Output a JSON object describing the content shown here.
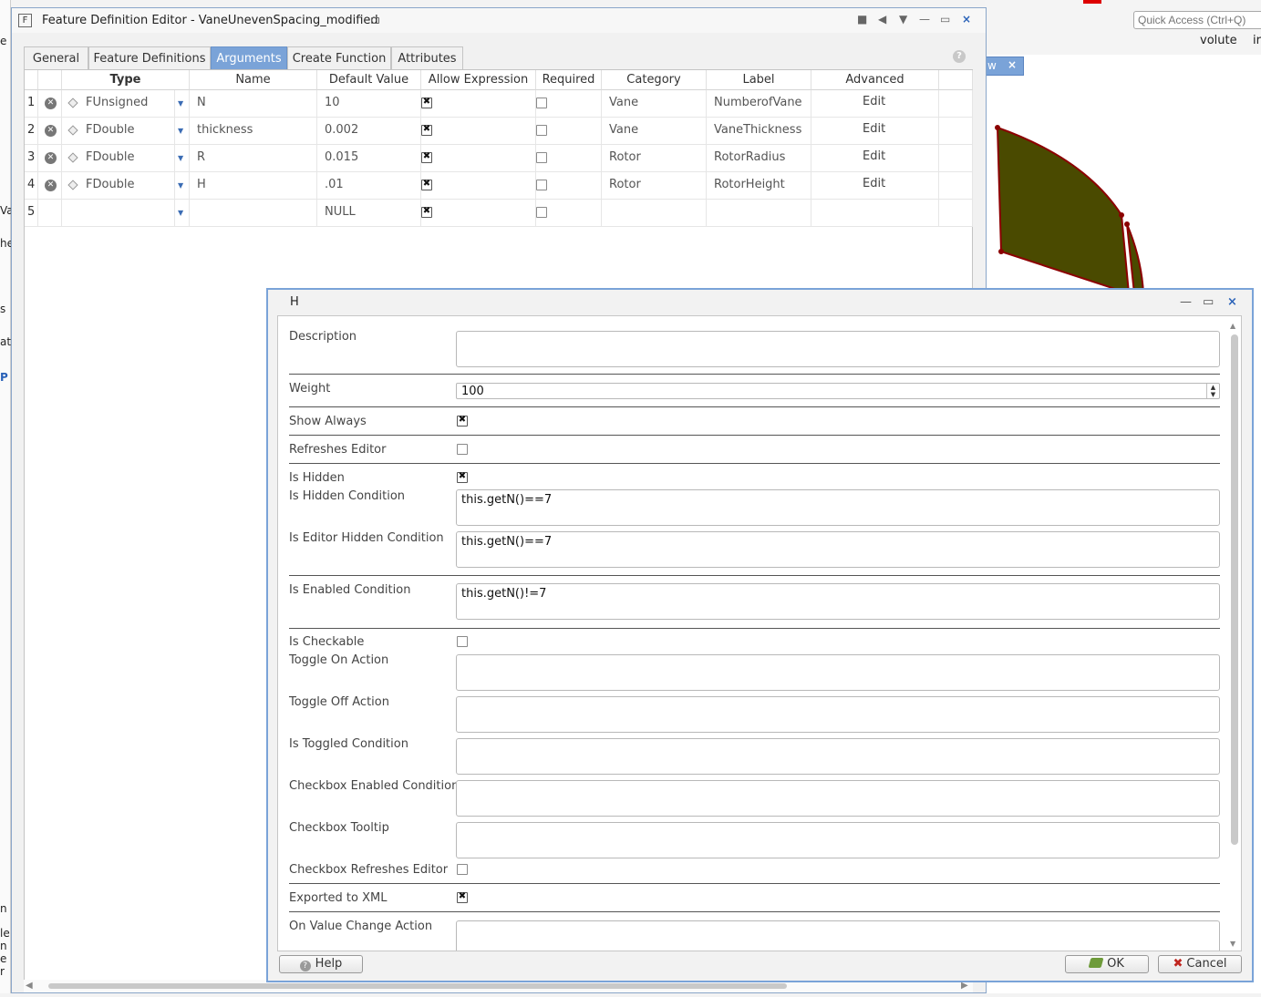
{
  "background": {
    "quick_access_placeholder": "Quick Access (Ctrl+Q)",
    "volute_label": "volute",
    "in_label": "ir",
    "tab_label": "w",
    "tab_close": "×",
    "left_fragments": [
      "e",
      "Va",
      "he",
      "s",
      "at",
      "P",
      "n",
      "le",
      "n",
      "e",
      "r"
    ],
    "shape_fill": "#4a4a00",
    "shape_stroke": "#8b0000"
  },
  "fde": {
    "app_icon": "F",
    "title": "Feature Definition Editor - VaneUnevenSpacing_modified",
    "controls": [
      "■",
      "◀",
      "▼",
      "—",
      "▭",
      "×"
    ],
    "tabs": [
      {
        "label": "General",
        "active": false
      },
      {
        "label": "Feature Definitions",
        "active": false
      },
      {
        "label": "Arguments",
        "active": true
      },
      {
        "label": "Create Function",
        "active": false
      },
      {
        "label": "Attributes",
        "active": false
      }
    ],
    "help_icon": "?",
    "columns": [
      "Type",
      "Name",
      "Default Value",
      "Allow Expression",
      "Required",
      "Category",
      "Label",
      "Advanced"
    ],
    "rows": [
      {
        "num": "1",
        "type": "FUnsigned",
        "name": "N",
        "default": "10",
        "allow_expr": true,
        "required": false,
        "category": "Vane",
        "label": "NumberofVane",
        "advanced": "Edit"
      },
      {
        "num": "2",
        "type": "FDouble",
        "name": "thickness",
        "default": "0.002",
        "allow_expr": true,
        "required": false,
        "category": "Vane",
        "label": "VaneThickness",
        "advanced": "Edit"
      },
      {
        "num": "3",
        "type": "FDouble",
        "name": "R",
        "default": "0.015",
        "allow_expr": true,
        "required": false,
        "category": "Rotor",
        "label": "RotorRadius",
        "advanced": "Edit"
      },
      {
        "num": "4",
        "type": "FDouble",
        "name": "H",
        "default": ".01",
        "allow_expr": true,
        "required": false,
        "category": "Rotor",
        "label": "RotorHeight",
        "advanced": "Edit"
      },
      {
        "num": "5",
        "type": "",
        "name": "",
        "default": "NULL",
        "allow_expr": true,
        "required": false,
        "category": "",
        "label": "",
        "advanced": ""
      }
    ]
  },
  "dialog": {
    "title": "H",
    "controls": [
      "—",
      "▭",
      "×"
    ],
    "fields": {
      "description": {
        "label": "Description",
        "value": ""
      },
      "weight": {
        "label": "Weight",
        "value": "100"
      },
      "show_always": {
        "label": "Show Always",
        "checked": true
      },
      "refreshes_editor": {
        "label": "Refreshes Editor",
        "checked": false
      },
      "is_hidden": {
        "label": "Is Hidden",
        "checked": true
      },
      "is_hidden_condition": {
        "label": "Is Hidden Condition",
        "value": "this.getN()==7"
      },
      "is_editor_hidden_condition": {
        "label": "Is Editor Hidden Condition",
        "value": "this.getN()==7"
      },
      "is_enabled_condition": {
        "label": "Is Enabled Condition",
        "value": "this.getN()!=7"
      },
      "is_checkable": {
        "label": "Is Checkable",
        "checked": false
      },
      "toggle_on_action": {
        "label": "Toggle On Action",
        "value": ""
      },
      "toggle_off_action": {
        "label": "Toggle Off Action",
        "value": ""
      },
      "is_toggled_condition": {
        "label": "Is Toggled Condition",
        "value": ""
      },
      "checkbox_enabled_condition": {
        "label": "Checkbox Enabled Condition",
        "value": ""
      },
      "checkbox_tooltip": {
        "label": "Checkbox Tooltip",
        "value": ""
      },
      "checkbox_refreshes_editor": {
        "label": "Checkbox Refreshes Editor",
        "checked": false
      },
      "exported_to_xml": {
        "label": "Exported to XML",
        "checked": true
      },
      "on_value_change_action": {
        "label": "On Value Change Action",
        "value": ""
      }
    },
    "help_label": "Help",
    "ok_label": "OK",
    "cancel_label": "Cancel"
  }
}
